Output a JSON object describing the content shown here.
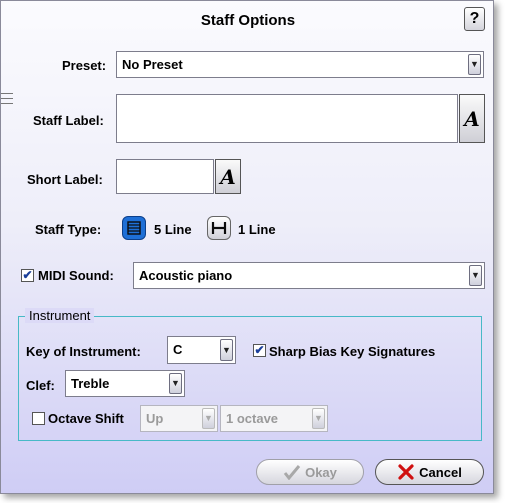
{
  "dialog": {
    "title": "Staff Options",
    "help_label": "?"
  },
  "preset": {
    "label": "Preset:",
    "value": "No Preset"
  },
  "staff_label": {
    "label": "Staff Label:",
    "value": ""
  },
  "short_label": {
    "label": "Short Label:",
    "value": ""
  },
  "font_button_glyph": "A",
  "staff_type": {
    "label": "Staff Type:",
    "option_5": "5 Line",
    "option_1": "1 Line",
    "selected": "5 Line"
  },
  "midi": {
    "label": "MIDI Sound:",
    "checked": true,
    "value": "Acoustic piano"
  },
  "instrument": {
    "group_label": "Instrument",
    "key_label": "Key of Instrument:",
    "key_value": "C",
    "sharp_bias_label": "Sharp Bias Key Signatures",
    "sharp_bias_checked": true,
    "clef_label": "Clef:",
    "clef_value": "Treble",
    "octave_shift_label": "Octave Shift",
    "octave_shift_checked": false,
    "octave_direction": "Up",
    "octave_amount": "1 octave"
  },
  "buttons": {
    "okay": "Okay",
    "cancel": "Cancel"
  },
  "colors": {
    "accent_blue": "#1e6fd6",
    "cancel_red": "#d01010",
    "group_border": "#47b9c7",
    "check_mark": "#1b3f9a"
  }
}
